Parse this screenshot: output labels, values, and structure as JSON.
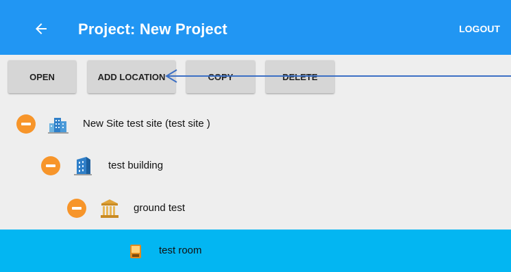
{
  "appbar": {
    "title": "Project: New Project",
    "logout_label": "LOGOUT",
    "back_icon": "arrow-back-icon",
    "color": "#2196f3"
  },
  "toolbar": {
    "open_label": "OPEN",
    "add_location_label": "ADD LOCATION",
    "copy_label": "COPY",
    "delete_label": "DELETE"
  },
  "tree": {
    "site": {
      "label": "New Site test site  (test site )",
      "icon": "site-buildings-icon"
    },
    "building": {
      "label": "test building",
      "icon": "building-icon"
    },
    "floor": {
      "label": "ground test",
      "icon": "floor-columns-icon"
    },
    "room": {
      "label": "test room",
      "icon": "room-icon",
      "selected_color": "#03b6f2"
    }
  },
  "colors": {
    "collapse_button": "#f7952a",
    "annotation_arrow": "#3b6fc4"
  }
}
